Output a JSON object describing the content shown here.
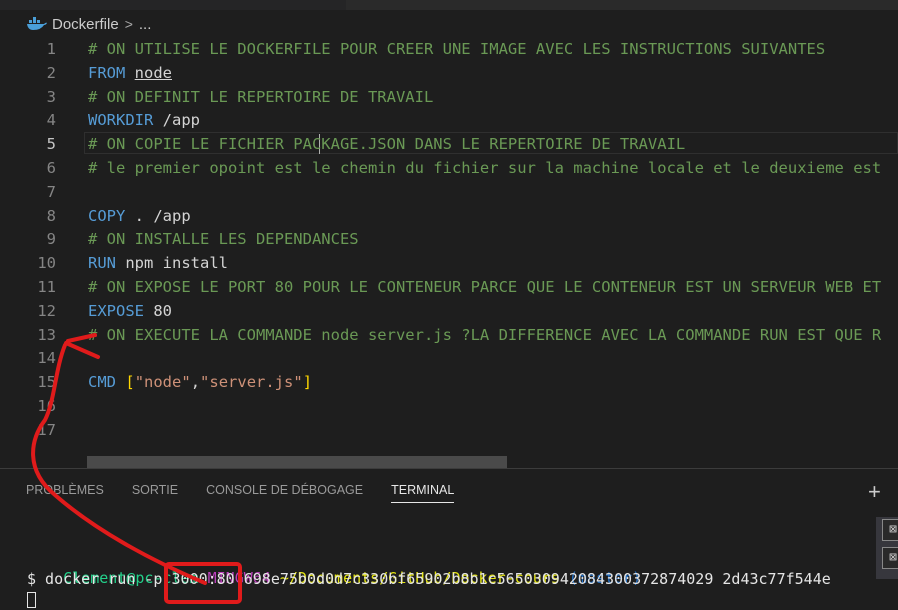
{
  "breadcrumb": {
    "file_icon": "docker-whale-icon",
    "filename": "Dockerfile",
    "separator": ">",
    "more": "..."
  },
  "editor": {
    "active_line": 5,
    "lines": [
      {
        "n": "1",
        "parts": [
          {
            "t": "# ON UTILISE LE DOCKERFILE POUR CREER UNE IMAGE AVEC LES INSTRUCTIONS SUIVANTES",
            "c": "cmt"
          }
        ]
      },
      {
        "n": "2",
        "parts": [
          {
            "t": "FROM",
            "c": "kw"
          },
          {
            "t": " ",
            "c": "txt"
          },
          {
            "t": "node",
            "c": "txt und"
          }
        ]
      },
      {
        "n": "3",
        "parts": [
          {
            "t": "# ON DEFINIT LE REPERTOIRE DE TRAVAIL",
            "c": "cmt"
          }
        ]
      },
      {
        "n": "4",
        "parts": [
          {
            "t": "WORKDIR",
            "c": "kw"
          },
          {
            "t": " /app",
            "c": "txt"
          }
        ]
      },
      {
        "n": "5",
        "parts": [
          {
            "t": "# ON COPIE LE FICHIER PACKAGE.JSON DANS LE REPERTOIRE DE TRAVAIL",
            "c": "cmt"
          }
        ]
      },
      {
        "n": "6",
        "parts": [
          {
            "t": "# le premier opoint est le chemin du fichier sur la machine locale et le deuxieme est",
            "c": "cmt"
          }
        ]
      },
      {
        "n": "7",
        "parts": []
      },
      {
        "n": "8",
        "parts": [
          {
            "t": "COPY",
            "c": "kw"
          },
          {
            "t": " . /app",
            "c": "txt"
          }
        ]
      },
      {
        "n": "9",
        "parts": [
          {
            "t": "# ON INSTALLE LES DEPENDANCES",
            "c": "cmt"
          }
        ]
      },
      {
        "n": "10",
        "parts": [
          {
            "t": "RUN",
            "c": "kw"
          },
          {
            "t": " npm install",
            "c": "txt"
          }
        ]
      },
      {
        "n": "11",
        "parts": [
          {
            "t": "# ON EXPOSE LE PORT 80 POUR LE CONTENEUR PARCE QUE LE CONTENEUR EST UN SERVEUR WEB ET",
            "c": "cmt"
          }
        ]
      },
      {
        "n": "12",
        "parts": [
          {
            "t": "EXPOSE",
            "c": "kw"
          },
          {
            "t": " 80",
            "c": "txt"
          }
        ]
      },
      {
        "n": "13",
        "parts": [
          {
            "t": "# ON EXECUTE LA COMMANDE node server.js ?LA DIFFERENCE AVEC LA COMMANDE RUN EST QUE R",
            "c": "cmt"
          }
        ]
      },
      {
        "n": "14",
        "parts": []
      },
      {
        "n": "15",
        "parts": [
          {
            "t": "CMD",
            "c": "kw"
          },
          {
            "t": " ",
            "c": "txt"
          },
          {
            "t": "[",
            "c": "brk"
          },
          {
            "t": "\"node\"",
            "c": "str"
          },
          {
            "t": ",",
            "c": "txt"
          },
          {
            "t": "\"server.js\"",
            "c": "str"
          },
          {
            "t": "]",
            "c": "brk"
          }
        ]
      },
      {
        "n": "16",
        "parts": []
      },
      {
        "n": "17",
        "parts": []
      }
    ]
  },
  "panel": {
    "tabs": [
      {
        "label": "PROBLÈMES",
        "active": false
      },
      {
        "label": "SORTIE",
        "active": false
      },
      {
        "label": "CONSOLE DE DÉBOGAGE",
        "active": false
      },
      {
        "label": "TERMINAL",
        "active": true
      }
    ],
    "add_terminal": "+",
    "terminal": {
      "prompt_user": "Clement@pc-clem",
      "prompt_system": "MINGW64",
      "prompt_path": "~/Documents/GitHub/Docker-cours",
      "prompt_branch": "(master)",
      "command_prefix": "$ docker run -p ",
      "command_port": "3000:80",
      "command_rest": " 698e75b0d0d7c330bf65902b8b1c565030942084300372874029 2d43c77f544e"
    }
  },
  "colors": {
    "background": "#1e1e1e",
    "comment": "#6a9955",
    "keyword": "#569cd6",
    "string": "#ce9178",
    "annotation": "#e01b1b"
  }
}
